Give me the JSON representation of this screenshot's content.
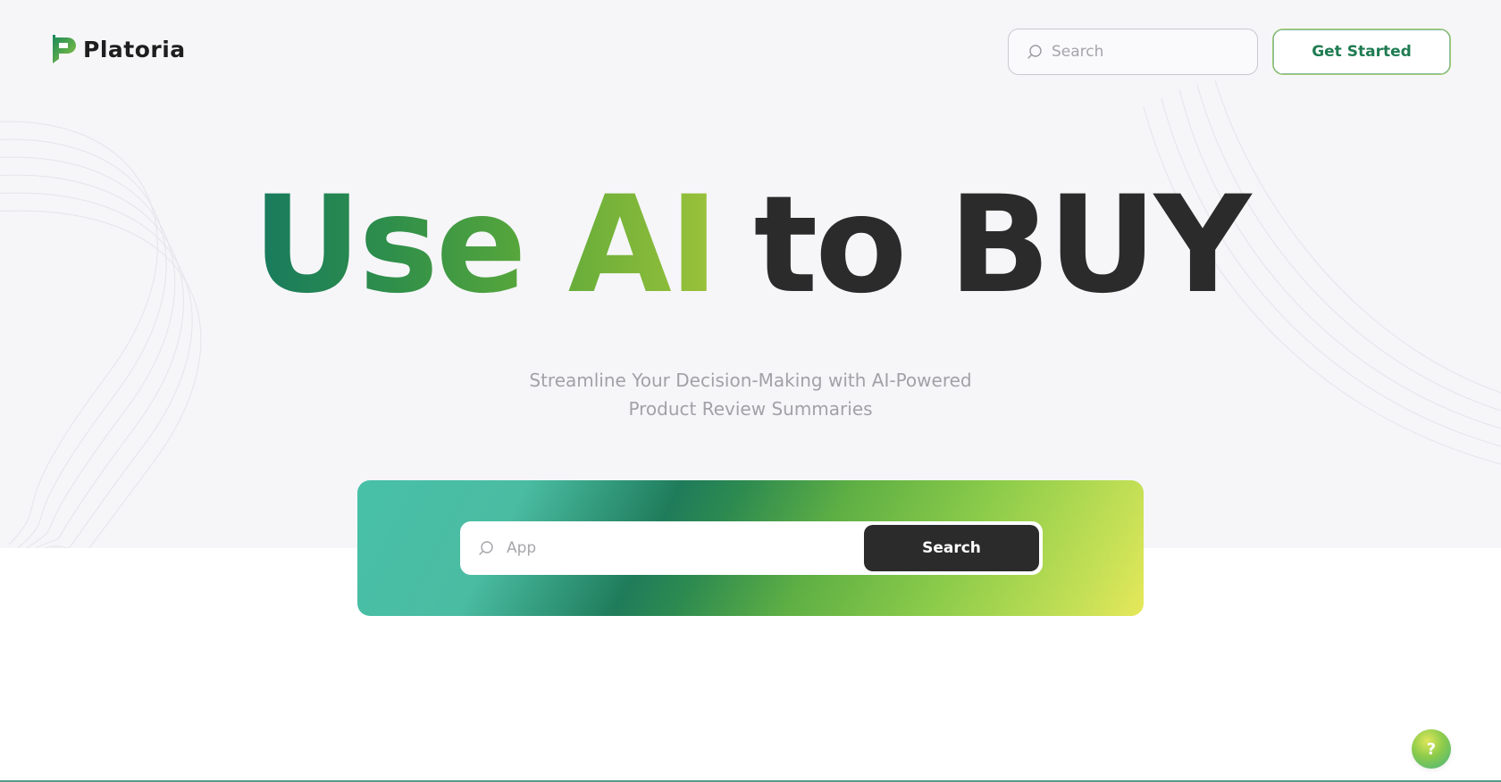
{
  "brand": {
    "name": "Platoria",
    "logo_icon": "platoria-logo-icon",
    "colors": {
      "green_dark": "#177a5e",
      "green": "#5aa83a",
      "lime": "#9cc23a",
      "teal": "#48c0a8",
      "dark": "#2b2b2b"
    }
  },
  "header": {
    "search_placeholder": "Search",
    "search_icon": "search-icon",
    "get_started_label": "Get Started"
  },
  "hero": {
    "headline_part1": "Use AI",
    "headline_part2": "to BUY",
    "subtitle_line1": "Streamline Your Decision-Making with AI-Powered",
    "subtitle_line2": "Product Review Summaries"
  },
  "search_panel": {
    "input_placeholder": "App",
    "search_icon": "search-icon",
    "button_label": "Search"
  },
  "help": {
    "label": "?",
    "icon": "help-icon"
  }
}
